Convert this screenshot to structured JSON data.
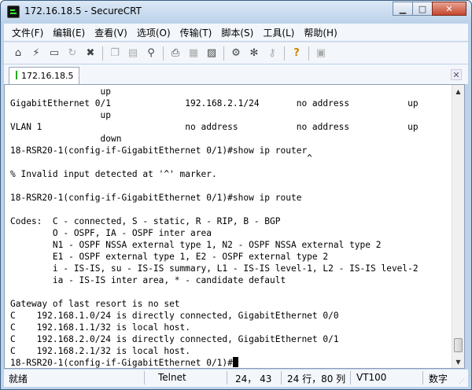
{
  "window": {
    "title": "172.16.18.5 - SecureCRT"
  },
  "menu": [
    "文件(F)",
    "编辑(E)",
    "查看(V)",
    "选项(O)",
    "传输(T)",
    "脚本(S)",
    "工具(L)",
    "帮助(H)"
  ],
  "toolbar": [
    {
      "icon": "connect-icon",
      "glyph": "⌂"
    },
    {
      "icon": "quick-connect-icon",
      "glyph": "⚡"
    },
    {
      "icon": "connect-tab-icon",
      "glyph": "▭"
    },
    {
      "icon": "reconnect-icon",
      "glyph": "↻"
    },
    {
      "icon": "disconnect-icon",
      "glyph": "✖"
    },
    {
      "icon": "copy-icon",
      "glyph": "❐"
    },
    {
      "icon": "paste-icon",
      "glyph": "▤"
    },
    {
      "icon": "find-icon",
      "glyph": "⚲"
    },
    {
      "icon": "print-icon",
      "glyph": "⎙"
    },
    {
      "icon": "print-selection-icon",
      "glyph": "▦"
    },
    {
      "icon": "printer-icon",
      "glyph": "▨"
    },
    {
      "icon": "session-options-icon",
      "glyph": "⚙"
    },
    {
      "icon": "global-options-icon",
      "glyph": "✻"
    },
    {
      "icon": "keymap-icon",
      "glyph": "⚷"
    },
    {
      "icon": "help-icon",
      "glyph": "?"
    },
    {
      "icon": "about-icon",
      "glyph": "▣"
    }
  ],
  "tab": {
    "label": "172.16.18.5"
  },
  "terminal": {
    "lines": [
      "                 up",
      "GigabitEthernet 0/1              192.168.2.1/24       no address           up",
      "                 up",
      "VLAN 1                           no address           no address           up",
      "                 down",
      "18-RSR20-1(config-if-GigabitEthernet 0/1)#show ip router",
      "                                                        ^",
      "% Invalid input detected at '^' marker.",
      "",
      "18-RSR20-1(config-if-GigabitEthernet 0/1)#show ip route",
      "",
      "Codes:  C - connected, S - static, R - RIP, B - BGP",
      "        O - OSPF, IA - OSPF inter area",
      "        N1 - OSPF NSSA external type 1, N2 - OSPF NSSA external type 2",
      "        E1 - OSPF external type 1, E2 - OSPF external type 2",
      "        i - IS-IS, su - IS-IS summary, L1 - IS-IS level-1, L2 - IS-IS level-2",
      "        ia - IS-IS inter area, * - candidate default",
      "",
      "Gateway of last resort is no set",
      "C    192.168.1.0/24 is directly connected, GigabitEthernet 0/0",
      "C    192.168.1.1/32 is local host.",
      "C    192.168.2.0/24 is directly connected, GigabitEthernet 0/1",
      "C    192.168.2.1/32 is local host."
    ],
    "prompt": "18-RSR20-1(config-if-GigabitEthernet 0/1)#"
  },
  "status": {
    "ready": "就绪",
    "protocol": "Telnet",
    "position": "24， 43",
    "size": "24 行，80 列",
    "emulation": "VT100",
    "numlock": "数字"
  },
  "colors": {
    "titlebar": "#bcd2ea",
    "close": "#c5472d"
  }
}
